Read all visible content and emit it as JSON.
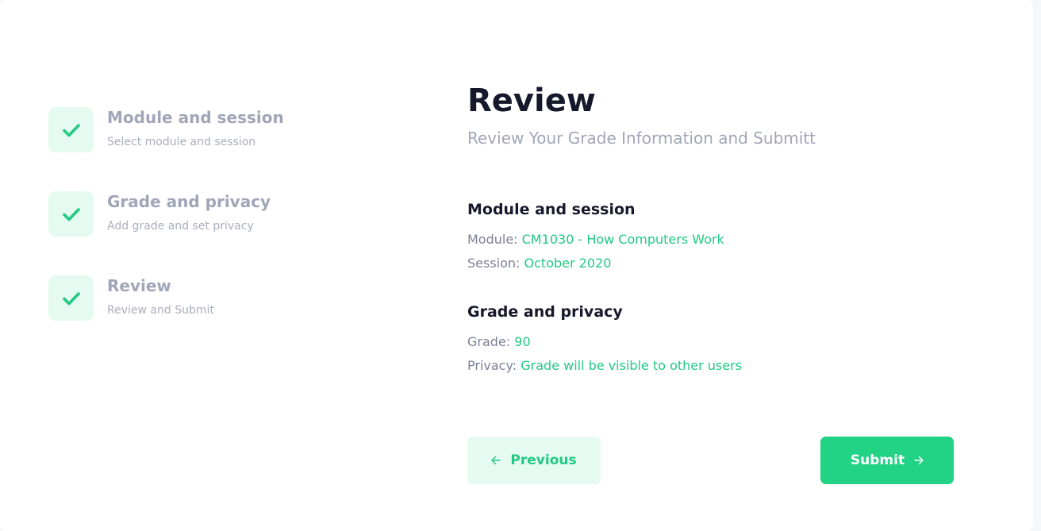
{
  "stepper": {
    "steps": [
      {
        "title": "Module and session",
        "subtitle": "Select module and session",
        "icon": "check-icon"
      },
      {
        "title": "Grade and privacy",
        "subtitle": "Add grade and set privacy",
        "icon": "check-icon"
      },
      {
        "title": "Review",
        "subtitle": "Review and Submit",
        "icon": "check-icon"
      }
    ]
  },
  "main": {
    "title": "Review",
    "subtitle": "Review Your Grade Information and Submitt",
    "sections": [
      {
        "title": "Module and session",
        "fields": [
          {
            "label": "Module:",
            "value": "CM1030 - How Computers Work"
          },
          {
            "label": "Session:",
            "value": "October 2020"
          }
        ]
      },
      {
        "title": "Grade and privacy",
        "fields": [
          {
            "label": "Grade:",
            "value": "90"
          },
          {
            "label": "Privacy:",
            "value": "Grade will be visible to other users"
          }
        ]
      }
    ]
  },
  "actions": {
    "previous_label": "Previous",
    "previous_icon": "arrow-left-icon",
    "submit_label": "Submit",
    "submit_icon": "arrow-right-icon"
  },
  "colors": {
    "accent": "#22d386",
    "accent_text": "#22c983",
    "accent_light": "#e5faf1",
    "heading": "#16192b",
    "muted": "#a0a6b8"
  }
}
